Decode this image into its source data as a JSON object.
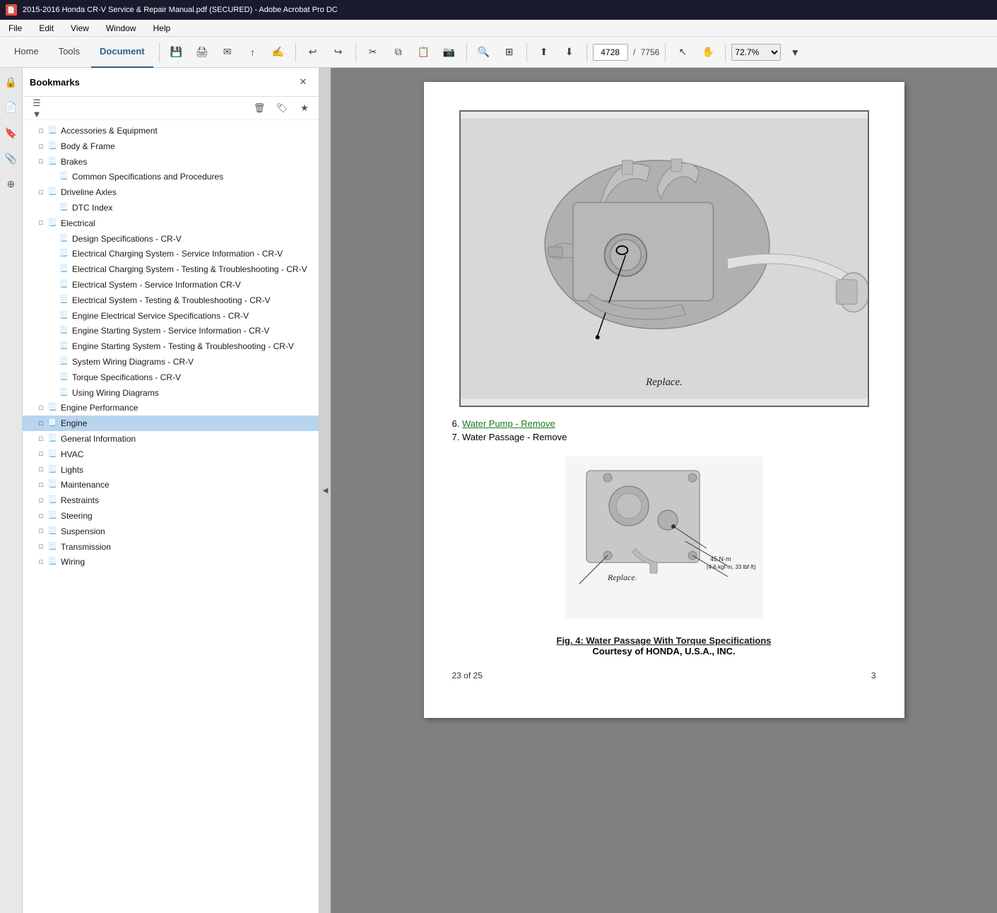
{
  "titleBar": {
    "icon": "📄",
    "text": "2015-2016 Honda CR-V Service & Repair Manual.pdf (SECURED) - Adobe Acrobat Pro DC"
  },
  "menuBar": {
    "items": [
      "File",
      "Edit",
      "View",
      "Window",
      "Help"
    ]
  },
  "toolbar": {
    "tabs": [
      "Home",
      "Tools",
      "Document"
    ],
    "activeTab": "Document",
    "pageInput": "4728",
    "pageSeparator": "/",
    "pageTotal": "7756",
    "zoom": "72.7%"
  },
  "bookmarks": {
    "title": "Bookmarks",
    "items": [
      {
        "indent": 1,
        "toggle": "□",
        "hasIcon": true,
        "label": "Accessories & Equipment",
        "id": "accessories"
      },
      {
        "indent": 1,
        "toggle": "□",
        "hasIcon": true,
        "label": "Body & Frame",
        "id": "body-frame"
      },
      {
        "indent": 1,
        "toggle": "□",
        "hasIcon": true,
        "label": "Brakes",
        "id": "brakes"
      },
      {
        "indent": 2,
        "toggle": "",
        "hasIcon": true,
        "label": "Common Specifications and Procedures",
        "id": "common-specs"
      },
      {
        "indent": 1,
        "toggle": "□",
        "hasIcon": true,
        "label": "Driveline Axles",
        "id": "driveline"
      },
      {
        "indent": 2,
        "toggle": "",
        "hasIcon": true,
        "label": "DTC Index",
        "id": "dtc-index"
      },
      {
        "indent": 1,
        "toggle": "□",
        "hasIcon": true,
        "label": "Electrical",
        "id": "electrical"
      },
      {
        "indent": 2,
        "toggle": "",
        "hasIcon": true,
        "label": "Design Specifications - CR-V",
        "id": "design-specs"
      },
      {
        "indent": 2,
        "toggle": "",
        "hasIcon": true,
        "label": "Electrical Charging System - Service Information - CR-V",
        "id": "elec-charging-service"
      },
      {
        "indent": 2,
        "toggle": "",
        "hasIcon": true,
        "label": "Electrical Charging System - Testing & Troubleshooting - CR-V",
        "id": "elec-charging-testing"
      },
      {
        "indent": 2,
        "toggle": "",
        "hasIcon": true,
        "label": "Electrical System - Service Information CR-V",
        "id": "elec-system-service"
      },
      {
        "indent": 2,
        "toggle": "",
        "hasIcon": true,
        "label": "Electrical System - Testing & Troubleshooting - CR-V",
        "id": "elec-system-testing"
      },
      {
        "indent": 2,
        "toggle": "",
        "hasIcon": true,
        "label": "Engine Electrical Service Specifications - CR-V",
        "id": "engine-elec-specs"
      },
      {
        "indent": 2,
        "toggle": "",
        "hasIcon": true,
        "label": "Engine Starting System - Service Information - CR-V",
        "id": "engine-starting-service"
      },
      {
        "indent": 2,
        "toggle": "",
        "hasIcon": true,
        "label": "Engine Starting System - Testing & Troubleshooting - CR-V",
        "id": "engine-starting-testing"
      },
      {
        "indent": 2,
        "toggle": "",
        "hasIcon": true,
        "label": "System Wiring Diagrams - CR-V",
        "id": "wiring-diagrams"
      },
      {
        "indent": 2,
        "toggle": "",
        "hasIcon": true,
        "label": "Torque Specifications - CR-V",
        "id": "torque-specs"
      },
      {
        "indent": 2,
        "toggle": "",
        "hasIcon": true,
        "label": "Using Wiring Diagrams",
        "id": "using-wiring"
      },
      {
        "indent": 1,
        "toggle": "□",
        "hasIcon": true,
        "label": "Engine Performance",
        "id": "engine-performance"
      },
      {
        "indent": 1,
        "toggle": "□",
        "hasIcon": true,
        "label": "Engine",
        "id": "engine",
        "selected": true
      },
      {
        "indent": 1,
        "toggle": "□",
        "hasIcon": true,
        "label": "General Information",
        "id": "general-info"
      },
      {
        "indent": 1,
        "toggle": "□",
        "hasIcon": true,
        "label": "HVAC",
        "id": "hvac"
      },
      {
        "indent": 1,
        "toggle": "□",
        "hasIcon": true,
        "label": "Lights",
        "id": "lights"
      },
      {
        "indent": 1,
        "toggle": "□",
        "hasIcon": true,
        "label": "Maintenance",
        "id": "maintenance"
      },
      {
        "indent": 1,
        "toggle": "□",
        "hasIcon": true,
        "label": "Restraints",
        "id": "restraints"
      },
      {
        "indent": 1,
        "toggle": "□",
        "hasIcon": true,
        "label": "Steering",
        "id": "steering"
      },
      {
        "indent": 1,
        "toggle": "□",
        "hasIcon": true,
        "label": "Suspension",
        "id": "suspension"
      },
      {
        "indent": 1,
        "toggle": "□",
        "hasIcon": true,
        "label": "Transmission",
        "id": "transmission"
      },
      {
        "indent": 1,
        "toggle": "□",
        "hasIcon": true,
        "label": "Wiring",
        "id": "wiring"
      }
    ]
  },
  "document": {
    "step6Link": "Water Pump - Remove",
    "step6Prefix": "6. ",
    "step7Text": "7. Water Passage - Remove",
    "replaceLabel": "Replace.",
    "captionLink": "Fig. 4: Water Passage With Torque Specifications",
    "captionText": "Courtesy of HONDA, U.S.A., INC.",
    "pageInfo": "23 of 25",
    "pageNumber": "3"
  },
  "icons": {
    "bookmark": "🔖",
    "close": "✕",
    "menu": "☰",
    "trash": "🗑",
    "tag": "🏷",
    "star": "★",
    "lock": "🔒",
    "hand": "✋",
    "cursor": "↖",
    "left": "‹",
    "right": "›",
    "save": "💾",
    "print": "🖨",
    "mail": "✉",
    "share": "↑",
    "undo": "↩",
    "redo": "↪",
    "cut": "✂",
    "copy": "⧉",
    "paste": "📋",
    "camera": "📷",
    "search": "🔍",
    "grid": "⊞",
    "upload": "⬆",
    "download": "⬇",
    "chevronRight": "▶",
    "chevronDown": "▼",
    "chevronLeft": "◀",
    "docIcon": "📃",
    "collapse": "◀"
  }
}
